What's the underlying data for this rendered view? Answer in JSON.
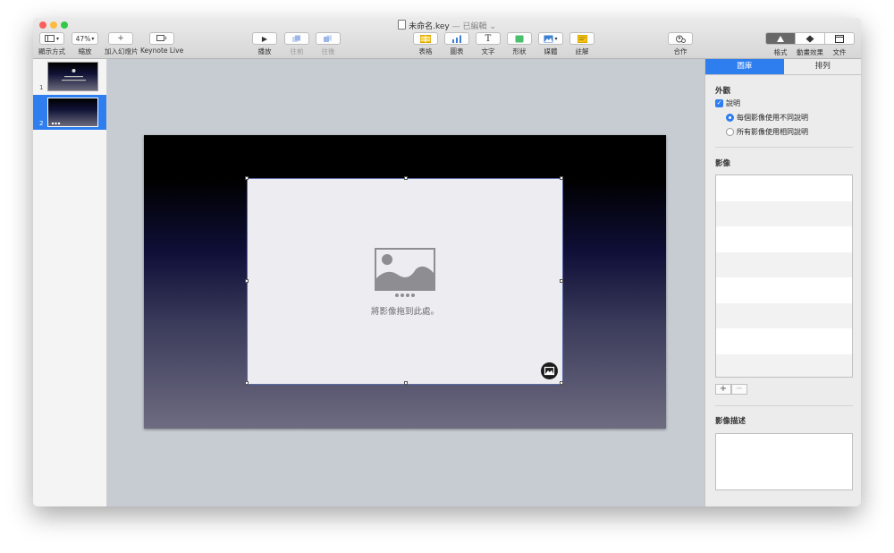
{
  "window": {
    "title": "未命名.key",
    "title_status": "— 已編輯"
  },
  "toolbar": {
    "view_label": "顯示方式",
    "zoom_value": "47%",
    "zoom_label": "縮放",
    "add_slide_label": "加入幻燈片",
    "keynote_live_label": "Keynote Live",
    "play_label": "播放",
    "forward_label": "往前",
    "backward_label": "往後",
    "table_label": "表格",
    "chart_label": "圖表",
    "text_label": "文字",
    "shape_label": "形狀",
    "media_label": "媒體",
    "comment_label": "註解",
    "collaborate_label": "合作",
    "format_label": "格式",
    "animate_label": "動畫效果",
    "document_label": "文件"
  },
  "navigator": {
    "slides": [
      {
        "number": "1"
      },
      {
        "number": "2"
      }
    ]
  },
  "canvas": {
    "placeholder_text": "將影像拖到此處。"
  },
  "inspector": {
    "tabs": [
      "圖庫",
      "排列"
    ],
    "appearance_title": "外觀",
    "caption_label": "說明",
    "radio_different": "每個影像使用不同說明",
    "radio_same": "所有影像使用相同說明",
    "images_title": "影像",
    "add_symbol": "+",
    "remove_symbol": "−",
    "description_title": "影像描述"
  },
  "colors": {
    "accent": "#2e7ef0",
    "traffic_red": "#fc605b",
    "traffic_yellow": "#fdbc40",
    "traffic_green": "#34c84a"
  }
}
